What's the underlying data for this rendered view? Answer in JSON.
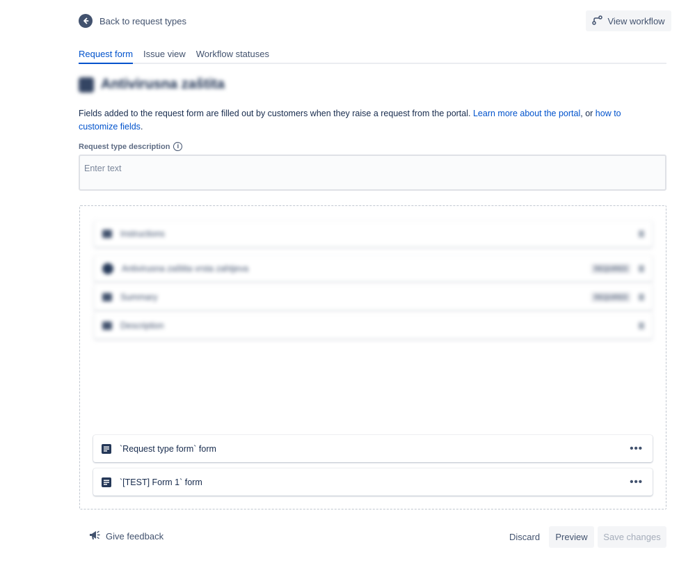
{
  "header": {
    "back_label": "Back to request types",
    "view_workflow_label": "View workflow"
  },
  "tabs": [
    {
      "label": "Request form",
      "active": true
    },
    {
      "label": "Issue view",
      "active": false
    },
    {
      "label": "Workflow statuses",
      "active": false
    }
  ],
  "request_type": {
    "title": "Antivirusna zaštita"
  },
  "intro": {
    "text_before": "Fields added to the request form are filled out by customers when they raise a request from the portal. ",
    "link_portal": "Learn more about the portal",
    "text_mid": ", or ",
    "link_customize": "how to customize fields",
    "text_after": "."
  },
  "description": {
    "label": "Request type description",
    "placeholder": "Enter text",
    "value": ""
  },
  "fields": [
    {
      "label": "Instructions",
      "required": false,
      "icon": "paragraph-icon"
    },
    {
      "label": "Antivirusna zaštita vrsta zahtjeva",
      "required": true,
      "icon": "select-icon"
    },
    {
      "label": "Summary",
      "required": true,
      "icon": "text-icon"
    },
    {
      "label": "Description",
      "required": false,
      "icon": "paragraph-icon"
    }
  ],
  "required_badge": "REQUIRED",
  "forms": [
    {
      "label": "`Request type form` form"
    },
    {
      "label": "`[TEST] Form 1` form"
    }
  ],
  "footer": {
    "feedback_label": "Give feedback",
    "discard_label": "Discard",
    "preview_label": "Preview",
    "save_label": "Save changes"
  },
  "colors": {
    "accent": "#0052cc",
    "text": "#172b4d",
    "subtle": "#42526e",
    "disabled": "#a5adba"
  }
}
